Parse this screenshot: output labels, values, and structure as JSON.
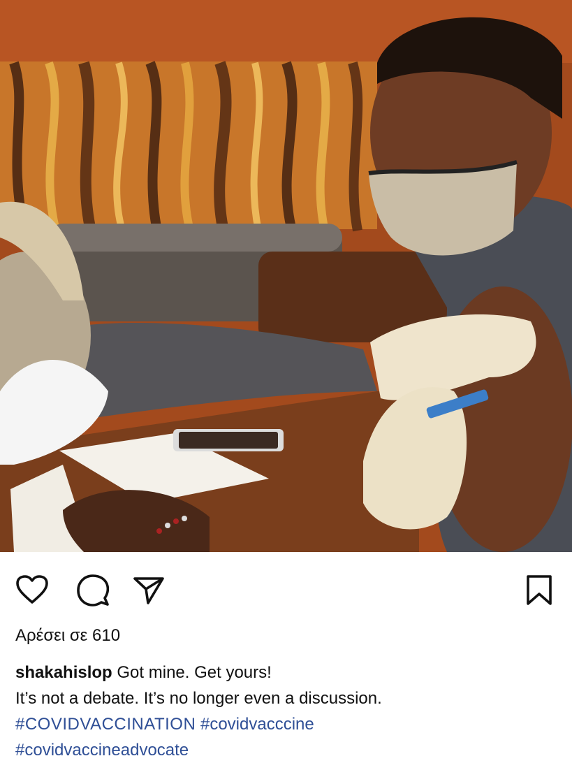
{
  "post": {
    "likes_text": "Αρέσει σε 610",
    "caption": {
      "username": "shakahislop",
      "text_line1": "Got mine. Get yours!",
      "text_line2": "It’s not a debate. It’s no longer even a discussion.",
      "hashtags": [
        "#COVIDVACCINATION",
        "#covidvacccine",
        "#covidvaccineadvocate"
      ]
    }
  },
  "actions": {
    "icons": [
      "heart-icon",
      "comment-icon",
      "share-icon",
      "bookmark-icon"
    ]
  },
  "colors": {
    "hashtag": "#2f4f96",
    "text": "#111111",
    "background": "#ffffff"
  }
}
